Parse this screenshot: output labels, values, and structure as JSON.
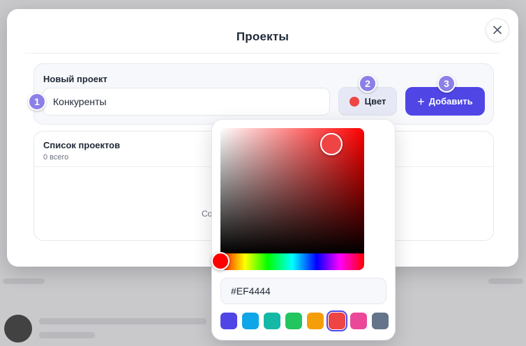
{
  "modal": {
    "title": "Проекты",
    "close_icon": "close-icon"
  },
  "new_project": {
    "label": "Новый проект",
    "name_value": "Конкуренты",
    "color_button_label": "Цвет",
    "selected_color": "#EF4444",
    "add_button_label": "Добавить",
    "add_icon": "plus-icon"
  },
  "project_list": {
    "label": "Список проектов",
    "count_text": "0 всего",
    "empty_text_partial": "Со"
  },
  "color_picker": {
    "hex_value": "#EF4444",
    "hue_base": "#FF0000",
    "swatches": [
      "#4F46E5",
      "#0EA5E9",
      "#14B8A6",
      "#22C55E",
      "#F59E0B",
      "#EF4444",
      "#EC4899",
      "#64748B"
    ],
    "selected_swatch_index": 5
  },
  "markers": [
    "1",
    "2",
    "3"
  ],
  "colors": {
    "accent": "#4F46E5",
    "marker": "#8B7FE8"
  }
}
